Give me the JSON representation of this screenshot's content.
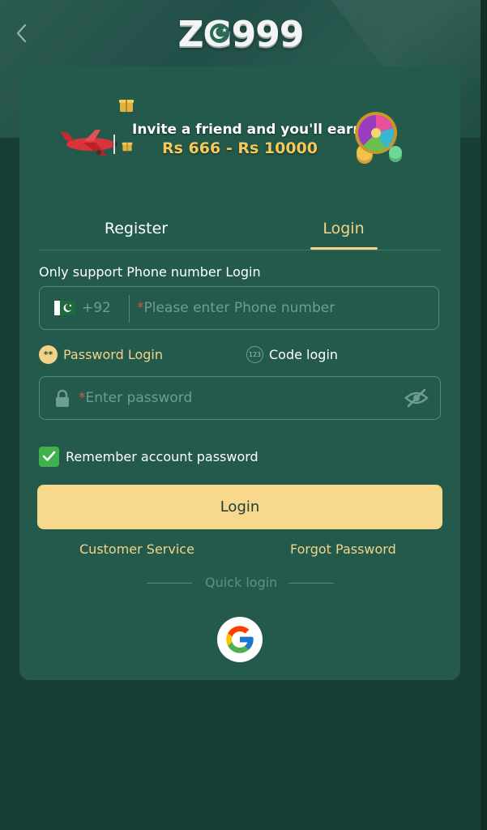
{
  "header": {
    "back_label": "Back",
    "logo_text": "ZG999"
  },
  "banner": {
    "line1": "Invite a friend and you'll earn",
    "line2": "Rs 666 - Rs 10000"
  },
  "tabs": [
    {
      "label": "Register",
      "active": false
    },
    {
      "label": "Login",
      "active": true
    }
  ],
  "form": {
    "support_text": "Only support Phone number Login",
    "country_code": "+92",
    "phone_placeholder": "Please enter Phone number",
    "required_mark": "*",
    "login_modes": [
      {
        "label": "Password Login",
        "icon_text": "**",
        "active": true
      },
      {
        "label": "Code login",
        "icon_text": "123",
        "active": false
      }
    ],
    "password_placeholder": "Enter password",
    "remember_label": "Remember account password",
    "remember_checked": true,
    "login_button": "Login"
  },
  "links": {
    "customer_service": "Customer Service",
    "forgot_password": "Forgot Password"
  },
  "quick_login": {
    "label": "Quick login",
    "providers": [
      "google-icon"
    ]
  },
  "colors": {
    "background": "#173f35",
    "card": "#235a4c",
    "accent": "#f4d389",
    "button": "#f8d88d",
    "checkbox": "#3fb24f",
    "required": "#e0504a"
  }
}
